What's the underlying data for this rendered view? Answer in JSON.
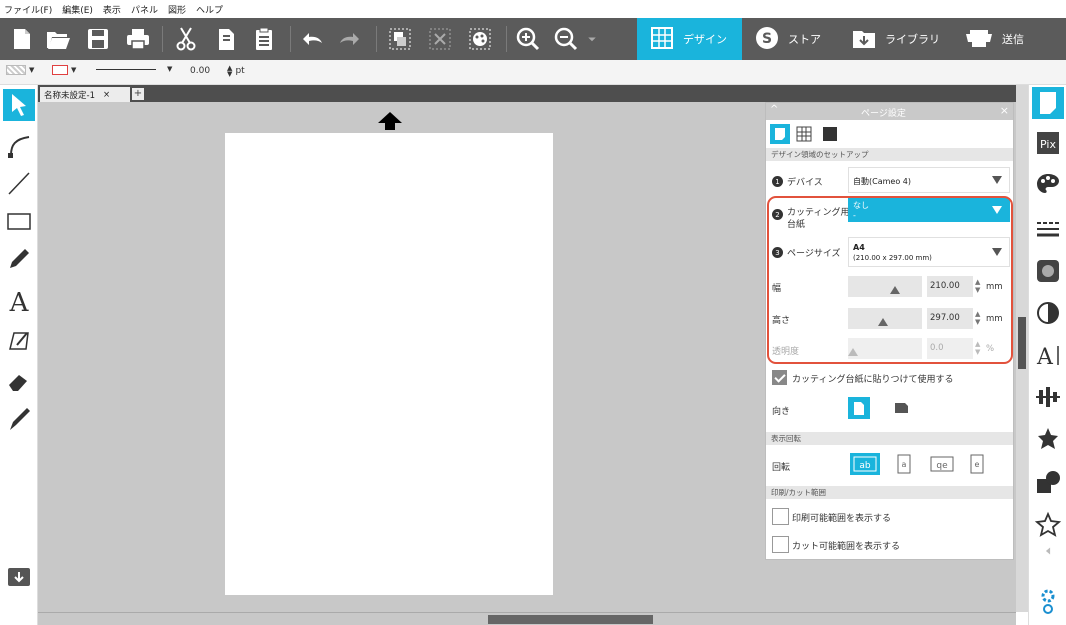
{
  "menu": [
    "ファイル(F)",
    "編集(E)",
    "表示",
    "パネル",
    "図形",
    "ヘルプ"
  ],
  "tabs": [
    {
      "label": "デザイン",
      "icon": "grid-icon",
      "active": true
    },
    {
      "label": "ストア",
      "icon": "store-s-icon",
      "active": false
    },
    {
      "label": "ライブラリ",
      "icon": "library-icon",
      "active": false
    },
    {
      "label": "送信",
      "icon": "send-cutter-icon",
      "active": false
    }
  ],
  "propbar": {
    "line_width": "0.00",
    "unit": "pt"
  },
  "document": {
    "tab_title": "名称未設定-1",
    "close": "×",
    "add": "+"
  },
  "panel": {
    "title": "ページ設定",
    "close": "×",
    "section_setup": "デザイン領域のセットアップ",
    "device": {
      "num": "1",
      "label": "デバイス",
      "value": "自動(Cameo 4)"
    },
    "cutting_mat": {
      "num": "2",
      "label_line1": "カッティング用",
      "label_line2": "台紙",
      "value_line1": "なし",
      "value_line2": "-"
    },
    "page_size": {
      "num": "3",
      "label": "ページサイズ",
      "value_line1": "A4",
      "value_line2": "(210.00 x 297.00 mm)"
    },
    "width": {
      "label": "幅",
      "value": "210.00",
      "unit": "mm"
    },
    "height": {
      "label": "高さ",
      "value": "297.00",
      "unit": "mm"
    },
    "opacity": {
      "label": "透明度",
      "value": "0.0",
      "unit": "%"
    },
    "stick_to_mat": {
      "label": "カッティング台紙に貼りつけて使用する",
      "checked": true
    },
    "orientation_label": "向き",
    "section_rotate": "表示回転",
    "rotate_label": "回転",
    "section_print": "印刷/カット範囲",
    "show_print_area": {
      "label": "印刷可能範囲を表示する",
      "checked": false
    },
    "show_cut_area": {
      "label": "カット可能範囲を表示する",
      "checked": false
    }
  },
  "colors": {
    "accent": "#1ab4dc",
    "toolbar": "#5b5b5b",
    "highlight_frame": "#e2523c"
  }
}
